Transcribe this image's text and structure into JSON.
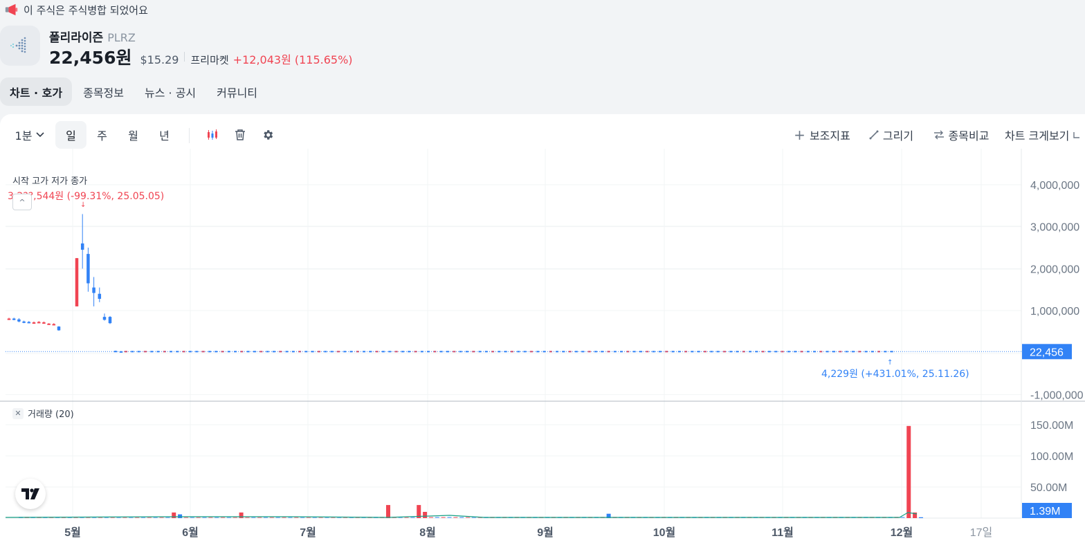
{
  "notice": {
    "text": "이 주식은 주식병합 되었어요",
    "icon": "megaphone-icon"
  },
  "stock": {
    "name": "폴리라이즌",
    "ticker": "PLRZ",
    "price": "22,456원",
    "price_usd": "$15.29",
    "market_label": "프리마켓",
    "change": "+12,043원 (115.65%)"
  },
  "tabs": [
    "차트 · 호가",
    "종목정보",
    "뉴스 · 공시",
    "커뮤니티"
  ],
  "toolbar": {
    "interval": "1분",
    "periods": [
      "일",
      "주",
      "월",
      "년"
    ],
    "right": {
      "indicator": "보조지표",
      "draw": "그리기",
      "compare": "종목비교",
      "enlarge": "차트 크게보기"
    }
  },
  "chart_labels": {
    "ohlc_legend": "시작 고가 저가 종가",
    "high_annotation": "3,2??,544원 (-99.31%, 25.05.05)",
    "low_annotation": "4,229원 (+431.01%, 25.11.26)",
    "volume_legend": "거래량 (20)"
  },
  "colors": {
    "up": "#f04452",
    "down": "#3182f6",
    "ma": "#16a085",
    "accent": "#3182f6"
  },
  "chart_data": [
    {
      "type": "candlestick",
      "title": "",
      "price_axis": {
        "ticks": [
          4000000,
          3000000,
          2000000,
          1000000,
          -1000000
        ],
        "tick_labels": [
          "4,000,000",
          "3,000,000",
          "2,000,000",
          "1,000,000",
          "-1,000,000"
        ],
        "current": 22456,
        "current_label": "22,456"
      },
      "x_ticks": [
        "5월",
        "6월",
        "7월",
        "8월",
        "9월",
        "10월",
        "11월",
        "12월",
        "17일"
      ],
      "candles": [
        {
          "o": 810000,
          "c": 800000,
          "h": 830000,
          "l": 780000,
          "dir": "up"
        },
        {
          "o": 810000,
          "c": 790000,
          "h": 830000,
          "l": 770000,
          "dir": "down"
        },
        {
          "o": 790000,
          "c": 740000,
          "h": 820000,
          "l": 720000,
          "dir": "down"
        },
        {
          "o": 740000,
          "c": 720000,
          "h": 760000,
          "l": 700000,
          "dir": "down"
        },
        {
          "o": 730000,
          "c": 710000,
          "h": 750000,
          "l": 700000,
          "dir": "down"
        },
        {
          "o": 700000,
          "c": 720000,
          "h": 740000,
          "l": 690000,
          "dir": "up"
        },
        {
          "o": 720000,
          "c": 730000,
          "h": 750000,
          "l": 700000,
          "dir": "up"
        },
        {
          "o": 710000,
          "c": 720000,
          "h": 740000,
          "l": 690000,
          "dir": "up"
        },
        {
          "o": 680000,
          "c": 690000,
          "h": 700000,
          "l": 670000,
          "dir": "up"
        },
        {
          "o": 670000,
          "c": 680000,
          "h": 700000,
          "l": 660000,
          "dir": "up"
        },
        {
          "o": 620000,
          "c": 530000,
          "h": 630000,
          "l": 520000,
          "dir": "down"
        },
        {
          "o": 1100000,
          "c": 2250000,
          "h": 2250000,
          "l": 1100000,
          "dir": "up"
        },
        {
          "o": 2600000,
          "c": 2450000,
          "h": 3300000,
          "l": 2000000,
          "dir": "down"
        },
        {
          "o": 2350000,
          "c": 1650000,
          "h": 2500000,
          "l": 1450000,
          "dir": "down"
        },
        {
          "o": 1550000,
          "c": 1420000,
          "h": 1800000,
          "l": 1100000,
          "dir": "down"
        },
        {
          "o": 1400000,
          "c": 1280000,
          "h": 1550000,
          "l": 1200000,
          "dir": "down"
        },
        {
          "o": 850000,
          "c": 780000,
          "h": 930000,
          "l": 760000,
          "dir": "down"
        },
        {
          "o": 850000,
          "c": 700000,
          "h": 870000,
          "l": 680000,
          "dir": "down"
        },
        {
          "o": 40000,
          "c": 35000,
          "h": 45000,
          "l": 30000,
          "dir": "down"
        },
        {
          "o": 30000,
          "c": 25000,
          "h": 35000,
          "l": 20000,
          "dir": "down"
        }
      ],
      "flat_series_value": 22456,
      "flat_series_count": 120
    },
    {
      "type": "bar",
      "title": "",
      "y_ticks": [
        150000000,
        100000000,
        50000000
      ],
      "y_tick_labels": [
        "150.00M",
        "100.00M",
        "50.00M"
      ],
      "current_label": "1.39M",
      "bars": [
        {
          "i": 25,
          "v": 9000000,
          "dir": "up"
        },
        {
          "i": 26,
          "v": 6000000,
          "dir": "down"
        },
        {
          "i": 36,
          "v": 9000000,
          "dir": "up"
        },
        {
          "i": 60,
          "v": 21000000,
          "dir": "up"
        },
        {
          "i": 65,
          "v": 21000000,
          "dir": "up"
        },
        {
          "i": 66,
          "v": 10000000,
          "dir": "up"
        },
        {
          "i": 96,
          "v": 7000000,
          "dir": "down"
        },
        {
          "i": 145,
          "v": 148000000,
          "dir": "up"
        },
        {
          "i": 146,
          "v": 9000000,
          "dir": "up"
        },
        {
          "i": 147,
          "v": 1390000,
          "dir": "down"
        }
      ],
      "baseline_volume": 2000000
    }
  ]
}
